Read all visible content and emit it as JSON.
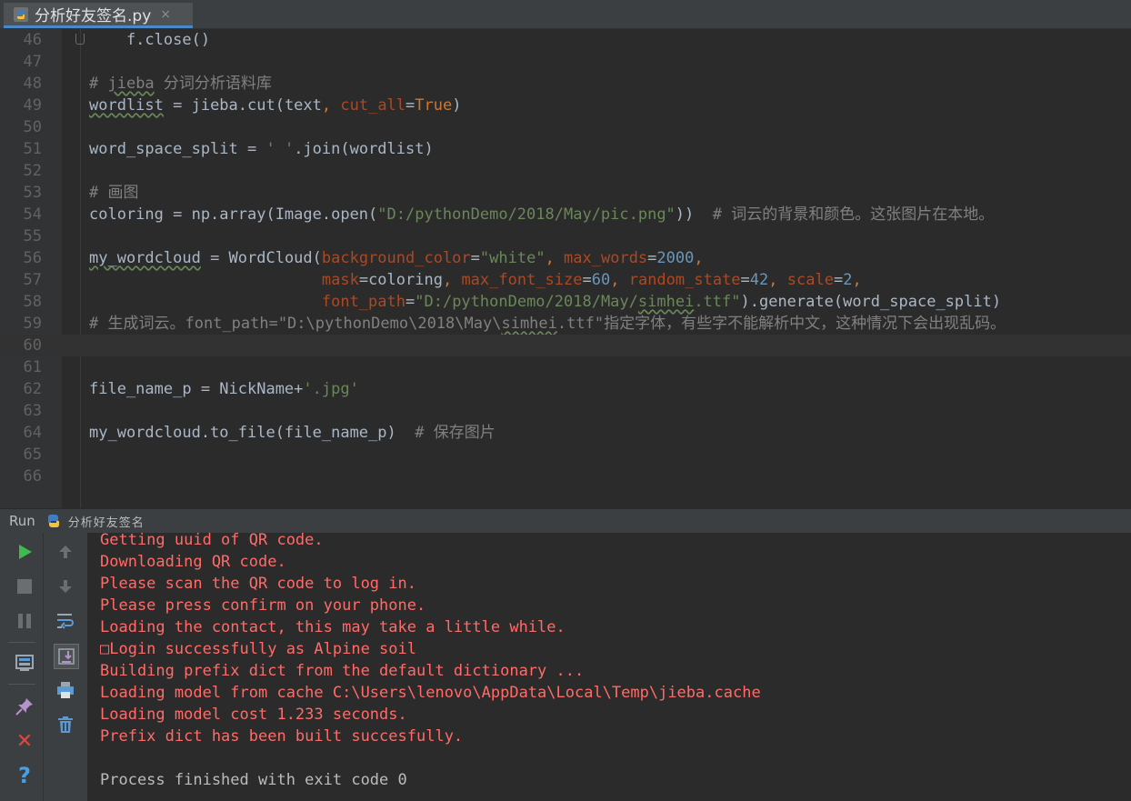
{
  "tab": {
    "title": "分析好友签名.py",
    "close": "×",
    "icon": "python-file-icon"
  },
  "editor": {
    "lines": [
      {
        "n": "46"
      },
      {
        "n": "47"
      },
      {
        "n": "48"
      },
      {
        "n": "49"
      },
      {
        "n": "50"
      },
      {
        "n": "51"
      },
      {
        "n": "52"
      },
      {
        "n": "53"
      },
      {
        "n": "54"
      },
      {
        "n": "55"
      },
      {
        "n": "56"
      },
      {
        "n": "57"
      },
      {
        "n": "58"
      },
      {
        "n": "59"
      },
      {
        "n": "60"
      },
      {
        "n": "61"
      },
      {
        "n": "62"
      },
      {
        "n": "63"
      },
      {
        "n": "64"
      },
      {
        "n": "65"
      },
      {
        "n": "66"
      }
    ],
    "code": {
      "l46": "    f.close()",
      "l48_hash": "# ",
      "l48_jieba": "jieba",
      "l48_rest": " 分词分析语料库",
      "l49_a": "wordlist",
      "l49_b": " = jieba.cut(text",
      "l49_c": ", ",
      "l49_d": "cut_all",
      "l49_e": "=",
      "l49_f": "True",
      "l49_g": ")",
      "l51_a": "word_space_split = ",
      "l51_b": "' '",
      "l51_c": ".join(wordlist)",
      "l53": "# 画图",
      "l54_a": "coloring = np.array(Image.open(",
      "l54_b": "\"D:/pythonDemo/2018/May/pic.png\"",
      "l54_c": "))  ",
      "l54_d": "# 词云的背景和颜色。这张图片在本地。",
      "l56_a": "my_wordcloud",
      "l56_b": " = WordCloud(",
      "l56_c": "background_color",
      "l56_d": "=",
      "l56_e": "\"white\"",
      "l56_f": ", ",
      "l56_g": "max_words",
      "l56_h": "=",
      "l56_i": "2000",
      "l56_j": ",",
      "l57_pad": "                         ",
      "l57_a": "mask",
      "l57_b": "=coloring",
      "l57_c": ", ",
      "l57_d": "max_font_size",
      "l57_e": "=",
      "l57_f": "60",
      "l57_g": ", ",
      "l57_h": "random_state",
      "l57_i": "=",
      "l57_j": "42",
      "l57_k": ", ",
      "l57_l": "scale",
      "l57_m": "=",
      "l57_n": "2",
      "l57_o": ",",
      "l58_pad": "                         ",
      "l58_a": "font_path",
      "l58_b": "=",
      "l58_c": "\"D:/pythonDemo/2018/May/",
      "l58_d": "simhei",
      "l58_e": ".ttf\"",
      "l58_f": ").generate(word_space_split)",
      "l59_a": "# 生成词云。font_path=\"D:\\pythonDemo\\2018\\May\\",
      "l59_b": "simhei",
      "l59_c": ".ttf\"指定字体，有些字不能解析中文，这种情况下会出现乱码。",
      "l62_a": "file_name_p = NickName+",
      "l62_b": "'.jpg'",
      "l64_a": "my_wordcloud.to_file(file_name_p)  ",
      "l64_b": "# 保存图片"
    }
  },
  "run": {
    "label": "Run",
    "config_name": "分析好友签名",
    "tools": {
      "run": "run-icon",
      "up": "up-arrow-icon",
      "stop": "stop-icon",
      "down": "down-arrow-icon",
      "pause": "pause-icon",
      "soft_wrap": "soft-wrap-icon",
      "dump": "dump-threads-icon",
      "scroll_end": "scroll-to-end-icon",
      "print": "print-icon",
      "pin": "pin-icon",
      "trash": "clear-all-icon",
      "close": "close-icon",
      "help": "help-icon"
    },
    "help_glyph": "?",
    "close_glyph": "✕",
    "output": [
      "Getting uuid of QR code.",
      "Downloading QR code.",
      "Please scan the QR code to log in.",
      "Please press confirm on your phone.",
      "Loading the contact, this may take a little while.",
      "□Login successfully as Alpine soil",
      "Building prefix dict from the default dictionary ...",
      "Loading model from cache C:\\Users\\lenovo\\AppData\\Local\\Temp\\jieba.cache",
      "Loading model cost 1.233 seconds.",
      "Prefix dict has been built succesfully.",
      "",
      "Process finished with exit code 0"
    ]
  },
  "colors": {
    "background": "#2b2b2b",
    "keyword": "#cc7832",
    "string": "#6a8759",
    "number": "#6897bb",
    "comment": "#808080",
    "param": "#aa4926",
    "stderr": "#ff6b68",
    "stdout": "#bbbbbb",
    "tab_accent": "#4a88c7"
  }
}
